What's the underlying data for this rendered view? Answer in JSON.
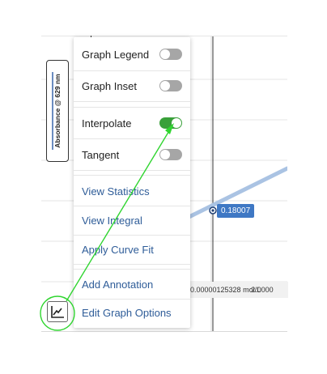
{
  "graph": {
    "yaxis_label": "Absorbance @ 629 nm",
    "point_value": "0.18007",
    "x_value_readout": "0.00000125328 mol/L",
    "x_value_cutoff": "2.0000",
    "colors": {
      "line": "#aac3e3",
      "point": "#1f3f73",
      "tag": "#3f78c4",
      "grid": "#e4e4e4"
    }
  },
  "menu": {
    "items": [
      {
        "label": "Graph Legend",
        "type": "toggle",
        "on": false
      },
      {
        "label": "Graph Inset",
        "type": "toggle",
        "on": false
      },
      {
        "label": "Interpolate",
        "type": "toggle",
        "on": true
      },
      {
        "label": "Tangent",
        "type": "toggle",
        "on": false
      },
      {
        "label": "View Statistics",
        "type": "link"
      },
      {
        "label": "View Integral",
        "type": "link"
      },
      {
        "label": "Apply Curve Fit",
        "type": "link"
      },
      {
        "label": "Add Annotation",
        "type": "link"
      },
      {
        "label": "Edit Graph Options",
        "type": "link"
      }
    ]
  },
  "options_button": {
    "icon": "line-chart-icon"
  },
  "annotation": {
    "color": "#30d530"
  }
}
